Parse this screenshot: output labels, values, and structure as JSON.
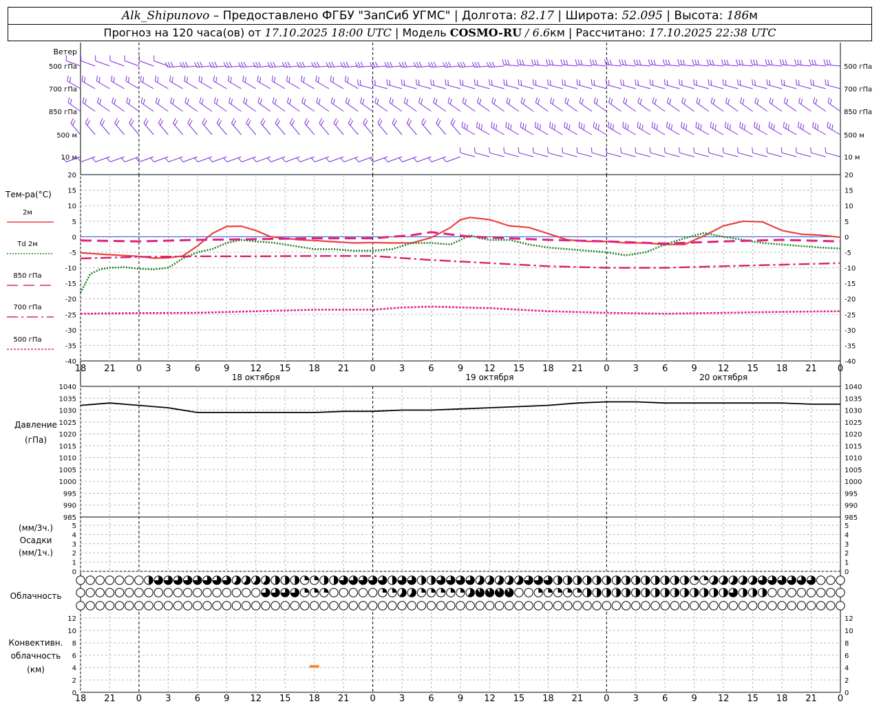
{
  "header": {
    "station": "Alk_Shipunovo",
    "provider_text": "– Предоставлено ФГБУ \"ЗапСиб УГМС\"",
    "lon_label": "Долгота:",
    "lon": "82.17",
    "lat_label": "Широта:",
    "lat": "52.095",
    "alt_label": "Высота:",
    "alt": "186",
    "alt_unit": "м",
    "forecast_label": "Прогноз на 120 часа(ов) от",
    "run_time": "17.10.2025 18:00 UTC",
    "model_label": "Модель",
    "model": "COSMO-RU",
    "resolution": "/ 6.6",
    "resolution_unit": "км",
    "calc_label": "Рассчитано:",
    "calc_time": "17.10.2025 22:38 UTC"
  },
  "labels": {
    "wind": "Ветер",
    "levels": [
      "500 гПа",
      "700 гПа",
      "850 гПа",
      "500 м",
      "10  м"
    ],
    "temp": "Тем-ра(°C)",
    "legend": [
      "2м",
      "Td  2м",
      "850 гПа",
      "700 гПа",
      "500 гПа"
    ],
    "pressure": [
      "Давление",
      "(гПа)"
    ],
    "precip": [
      "(мм/3ч.)",
      "Осадки",
      "(мм/1ч.)"
    ],
    "cloud": "Облачность",
    "conv": [
      "Конвективн.",
      "облачность",
      "(км)"
    ]
  },
  "colors": {
    "t2m": "#e84040",
    "td2m": "#1a7f1a",
    "t850": "#e0207a",
    "t700": "#d8206a",
    "t500": "#e0208a",
    "wind": "#7a28d8",
    "pressure": "#000000",
    "convective": "#f08a30",
    "zero_line": "#2850e0"
  },
  "chart_data": {
    "type": "line",
    "time_ticks": [
      "18",
      "21",
      "0",
      "3",
      "6",
      "9",
      "12",
      "15",
      "18",
      "21",
      "0",
      "3",
      "6",
      "9",
      "12",
      "15",
      "18",
      "21",
      "0",
      "3",
      "6",
      "9",
      "12",
      "15",
      "18",
      "21",
      "0"
    ],
    "dates": [
      {
        "label": "18 октября",
        "at_hour": 12
      },
      {
        "label": "19 октября",
        "at_hour": 36
      },
      {
        "label": "20 октября",
        "at_hour": 60
      }
    ],
    "x_range_hours": [
      0,
      78
    ],
    "temperature": {
      "ylim": [
        -40,
        20
      ],
      "yticks": [
        20,
        15,
        10,
        5,
        0,
        -5,
        -10,
        -15,
        -20,
        -25,
        -30,
        -35,
        -40
      ],
      "series": [
        {
          "name": "2м",
          "x": [
            0,
            3,
            6,
            7.5,
            9,
            10.5,
            12,
            13.5,
            15,
            16.5,
            18,
            19.5,
            21,
            22.5,
            24,
            26,
            28,
            30,
            32,
            34,
            36,
            38,
            39,
            40,
            42,
            44,
            46,
            48,
            50,
            52,
            54,
            56,
            58,
            60,
            62,
            64,
            66,
            68,
            70,
            72,
            74,
            76,
            78
          ],
          "values": [
            -5.2,
            -5.8,
            -6.3,
            -6.9,
            -6.8,
            -6.2,
            -3,
            1,
            3.3,
            3.4,
            2,
            0,
            -0.5,
            -1,
            -1.2,
            -1.6,
            -2,
            -1.9,
            -2,
            -2,
            -0.3,
            3,
            5.5,
            6.2,
            5.5,
            3.5,
            3,
            1,
            -1,
            -1.5,
            -1.5,
            -2,
            -2,
            -2.5,
            -2.5,
            0.3,
            3.5,
            5,
            4.8,
            2,
            0.8,
            0.5,
            -0.2
          ]
        },
        {
          "name": "Td  2м",
          "x": [
            0,
            1,
            2,
            3,
            4.5,
            6,
            7.5,
            9,
            10.5,
            12,
            13.5,
            15,
            16.5,
            18,
            20,
            22,
            24,
            26,
            28,
            30,
            32,
            34,
            35,
            36,
            38,
            39,
            40,
            41,
            42,
            43,
            44,
            46,
            48,
            50,
            52,
            54,
            56,
            58,
            60,
            62,
            64,
            66,
            68,
            70,
            72,
            74,
            76,
            78
          ],
          "values": [
            -18,
            -12,
            -10.5,
            -10,
            -9.8,
            -10.3,
            -10.5,
            -10,
            -7,
            -5,
            -4,
            -2,
            -1,
            -1.5,
            -2,
            -3,
            -4,
            -4,
            -4.5,
            -4.5,
            -4,
            -2,
            -2,
            -2,
            -2.5,
            -1,
            0.5,
            -0.5,
            -1,
            -1,
            -1,
            -2.5,
            -3.5,
            -4,
            -4.5,
            -5,
            -6,
            -5,
            -2.5,
            -0.5,
            1.2,
            0,
            -1,
            -2,
            -2.5,
            -3,
            -3.5,
            -3.8
          ]
        },
        {
          "name": "850 гПа",
          "x": [
            0,
            6,
            12,
            18,
            24,
            30,
            34,
            36,
            40,
            44,
            48,
            54,
            60,
            66,
            72,
            78
          ],
          "values": [
            -1.2,
            -1.5,
            -1,
            -0.8,
            -0.5,
            -0.5,
            0.5,
            1.5,
            0,
            -0.5,
            -1,
            -1.5,
            -2.2,
            -1.5,
            -1,
            -1.5
          ]
        },
        {
          "name": "700 гПа",
          "x": [
            0,
            6,
            12,
            18,
            24,
            30,
            36,
            42,
            48,
            54,
            60,
            66,
            72,
            78
          ],
          "values": [
            -7,
            -6.5,
            -6.3,
            -6.3,
            -6.2,
            -6.2,
            -7.5,
            -8.5,
            -9.5,
            -10,
            -10,
            -9.5,
            -9,
            -8.5
          ]
        },
        {
          "name": "500 гПа",
          "x": [
            0,
            6,
            12,
            18,
            24,
            30,
            33,
            36,
            42,
            48,
            54,
            60,
            66,
            72,
            78
          ],
          "values": [
            -24.8,
            -24.6,
            -24.5,
            -24,
            -23.5,
            -23.5,
            -22.8,
            -22.5,
            -23,
            -24,
            -24.5,
            -24.8,
            -24.5,
            -24.2,
            -24
          ]
        }
      ]
    },
    "pressure": {
      "ylim": [
        985,
        1040
      ],
      "yticks": [
        1040,
        1035,
        1030,
        1025,
        1020,
        1015,
        1010,
        1005,
        1000,
        995,
        990,
        985
      ],
      "x": [
        0,
        3,
        6,
        9,
        12,
        15,
        18,
        21,
        24,
        27,
        30,
        33,
        36,
        39,
        42,
        45,
        48,
        51,
        54,
        57,
        60,
        63,
        66,
        69,
        72,
        75,
        78
      ],
      "values": [
        1032,
        1033,
        1032,
        1031,
        1029,
        1029,
        1029,
        1029,
        1029,
        1029.5,
        1029.5,
        1030,
        1030,
        1030.5,
        1031,
        1031.5,
        1032,
        1033,
        1033.5,
        1033.5,
        1033,
        1033,
        1033,
        1033,
        1033,
        1032.5,
        1032.5
      ]
    },
    "precipitation": {
      "ylim": [
        0,
        5
      ],
      "yticks": [
        5,
        4,
        3,
        2,
        1,
        0
      ],
      "values": []
    },
    "cloud_cover": {
      "columns": 79,
      "rows": [
        {
          "name": "high",
          "fills": [
            {
              "from": 0,
              "to": 6,
              "v": 0
            },
            {
              "from": 7,
              "to": 7,
              "v": 0.5
            },
            {
              "from": 8,
              "to": 15,
              "v": 0.75
            },
            {
              "from": 16,
              "to": 19,
              "v": 0.6
            },
            {
              "from": 20,
              "to": 22,
              "v": 0.5
            },
            {
              "from": 23,
              "to": 24,
              "v": 0.25
            },
            {
              "from": 25,
              "to": 26,
              "v": 0.5
            },
            {
              "from": 27,
              "to": 31,
              "v": 0.75
            },
            {
              "from": 32,
              "to": 32,
              "v": 0.5
            },
            {
              "from": 33,
              "to": 34,
              "v": 0.75
            },
            {
              "from": 35,
              "to": 36,
              "v": 0.5
            },
            {
              "from": 37,
              "to": 40,
              "v": 0.75
            },
            {
              "from": 41,
              "to": 45,
              "v": 0.6
            },
            {
              "from": 46,
              "to": 48,
              "v": 0.75
            },
            {
              "from": 49,
              "to": 62,
              "v": 0.5
            },
            {
              "from": 63,
              "to": 64,
              "v": 0.25
            },
            {
              "from": 65,
              "to": 69,
              "v": 0.6
            },
            {
              "from": 70,
              "to": 75,
              "v": 0.75
            },
            {
              "from": 76,
              "to": 78,
              "v": 0
            }
          ]
        },
        {
          "name": "middle",
          "fills": [
            {
              "from": 0,
              "to": 18,
              "v": 0
            },
            {
              "from": 19,
              "to": 22,
              "v": 0.75
            },
            {
              "from": 23,
              "to": 25,
              "v": 0.25
            },
            {
              "from": 26,
              "to": 30,
              "v": 0
            },
            {
              "from": 31,
              "to": 32,
              "v": 0.25
            },
            {
              "from": 33,
              "to": 34,
              "v": 0.6
            },
            {
              "from": 35,
              "to": 36,
              "v": 0.25
            },
            {
              "from": 37,
              "to": 39,
              "v": 0.25
            },
            {
              "from": 40,
              "to": 40,
              "v": 0.6
            },
            {
              "from": 41,
              "to": 44,
              "v": 0.9
            },
            {
              "from": 45,
              "to": 46,
              "v": 0
            },
            {
              "from": 47,
              "to": 51,
              "v": 0.25
            },
            {
              "from": 52,
              "to": 59,
              "v": 0.5
            },
            {
              "from": 60,
              "to": 64,
              "v": 0.5
            },
            {
              "from": 65,
              "to": 66,
              "v": 0.5
            },
            {
              "from": 67,
              "to": 67,
              "v": 0.75
            },
            {
              "from": 68,
              "to": 70,
              "v": 0.5
            },
            {
              "from": 71,
              "to": 78,
              "v": 0
            }
          ]
        },
        {
          "name": "low",
          "fills": [
            {
              "from": 0,
              "to": 78,
              "v": 0
            }
          ]
        }
      ]
    },
    "convective_cloud": {
      "ylim": [
        0,
        13
      ],
      "yticks": [
        12,
        10,
        8,
        6,
        4,
        2,
        0
      ],
      "segments": [
        {
          "x_hour": 24,
          "base": 4,
          "top": 4.4
        }
      ]
    },
    "wind_levels": [
      "500 гПа",
      "700 гПа",
      "850 гПа",
      "500 м",
      "10  м"
    ]
  }
}
